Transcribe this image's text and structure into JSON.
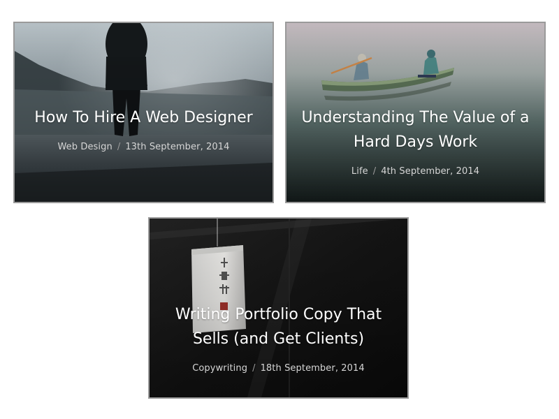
{
  "posts": [
    {
      "title": "How To Hire A Web Designer",
      "category": "Web Design",
      "separator": "/",
      "date": "13th September, 2014",
      "image": "man-standing-on-misty-lake-dock-photo"
    },
    {
      "title": "Understanding The Value of a Hard Days Work",
      "category": "Life",
      "separator": "/",
      "date": "4th September, 2014",
      "image": "two-people-rowing-canoe-in-fog-photo"
    },
    {
      "title": "Writing Portfolio Copy That Sells (and Get Clients)",
      "category": "Copywriting",
      "separator": "/",
      "date": "18th September, 2014",
      "image": "paper-lantern-with-chinese-characters-photo"
    }
  ]
}
